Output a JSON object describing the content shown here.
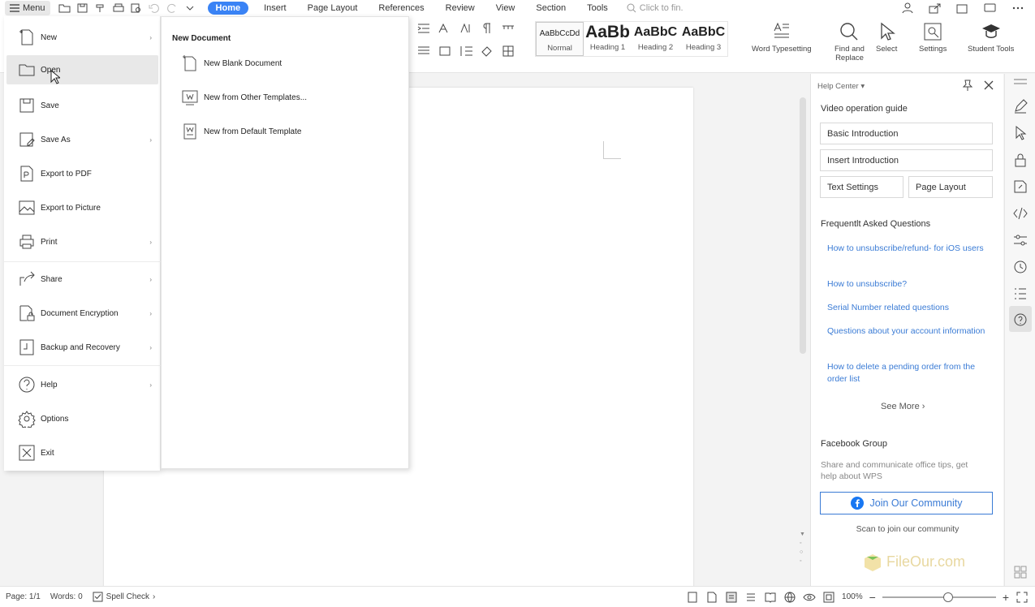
{
  "topbar": {
    "menu_label": "Menu",
    "tabs": [
      "Home",
      "Insert",
      "Page Layout",
      "References",
      "Review",
      "View",
      "Section",
      "Tools"
    ],
    "search_placeholder": "Click to fin."
  },
  "ribbon": {
    "styles": [
      {
        "preview": "AaBbCcDd",
        "name": "Normal"
      },
      {
        "preview": "AaBb",
        "name": "Heading 1"
      },
      {
        "preview": "AaBbC",
        "name": "Heading 2"
      },
      {
        "preview": "AaBbC",
        "name": "Heading 3"
      }
    ],
    "word_typesetting": "Word Typesetting",
    "find_replace_1": "Find and",
    "find_replace_2": "Replace",
    "select": "Select",
    "settings": "Settings",
    "student_tools": "Student Tools"
  },
  "file_menu": {
    "items": [
      {
        "label": "New",
        "icon": "new-document-icon",
        "arrow": true
      },
      {
        "label": "Open",
        "icon": "folder-open-icon",
        "arrow": false
      },
      {
        "label": "Save",
        "icon": "save-icon",
        "arrow": false
      },
      {
        "label": "Save As",
        "icon": "save-as-icon",
        "arrow": true
      },
      {
        "label": "Export to PDF",
        "icon": "pdf-icon",
        "arrow": false
      },
      {
        "label": "Export to Picture",
        "icon": "picture-icon",
        "arrow": false
      },
      {
        "label": "Print",
        "icon": "print-icon",
        "arrow": true
      },
      {
        "label": "Share",
        "icon": "share-icon",
        "arrow": true
      },
      {
        "label": "Document Encryption",
        "icon": "lock-document-icon",
        "arrow": true
      },
      {
        "label": "Backup and Recovery",
        "icon": "backup-icon",
        "arrow": true
      },
      {
        "label": "Help",
        "icon": "help-icon",
        "arrow": true
      },
      {
        "label": "Options",
        "icon": "gear-icon",
        "arrow": false
      },
      {
        "label": "Exit",
        "icon": "exit-icon",
        "arrow": false
      }
    ],
    "arrow_glyph": "›"
  },
  "new_submenu": {
    "title": "New Document",
    "items": [
      "New Blank Document",
      "New from Other Templates...",
      "New from Default Template"
    ]
  },
  "help_center": {
    "title": "Help Center",
    "video_title": "Video operation guide",
    "buttons": [
      "Basic Introduction",
      "Insert Introduction",
      "Text Settings",
      "Page Layout"
    ],
    "faq_title": "Frequentlt Asked Questions",
    "faqs": [
      "How to unsubscribe/refund- for iOS users",
      "How to unsubscribe?",
      "Serial Number related questions",
      "Questions about your account information",
      "How to delete a pending order from the order list"
    ],
    "see_more": "See More",
    "facebook_title": "Facebook Group",
    "facebook_desc": "Share and communicate office tips, get help about WPS",
    "join_label": "Join Our Community",
    "scan_label": "Scan to join our community"
  },
  "status": {
    "page": "Page: 1/1",
    "words": "Words: 0",
    "spell_check": "Spell Check",
    "zoom": "100%",
    "zoom_fraction": 0.58
  },
  "watermark": "FileOur.com",
  "colors": {
    "accent": "#3a83f5",
    "link": "#3a7bd5",
    "facebook": "#1877f2"
  }
}
